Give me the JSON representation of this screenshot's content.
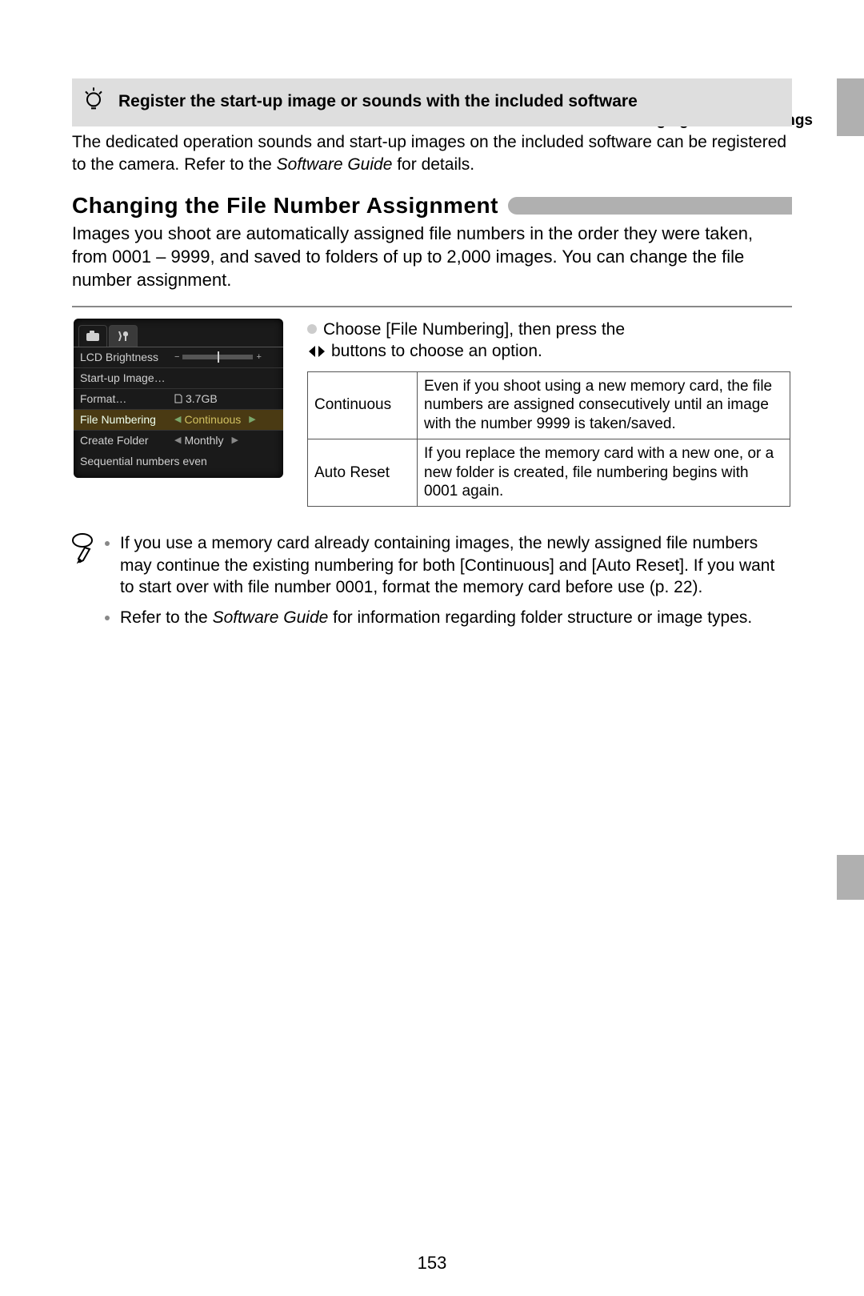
{
  "header": {
    "title": "Changing Camera Settings"
  },
  "tip": {
    "heading": "Register the start-up image or sounds with the included software",
    "body_a": "The dedicated operation sounds and start-up images on the included software can be registered to the camera. Refer to the ",
    "body_em": "Software Guide",
    "body_b": " for details."
  },
  "section": {
    "title": "Changing the File Number Assignment",
    "body": "Images you shoot are automatically assigned file numbers in the order they were taken, from 0001 – 9999, and saved to folders of up to 2,000 images. You can change the file number assignment."
  },
  "lcd": {
    "rows": {
      "brightness": "LCD Brightness",
      "startup": "Start-up Image…",
      "format": "Format…",
      "format_v": "3.7GB",
      "file_num": "File Numbering",
      "file_num_v": "Continuous",
      "folder": "Create Folder",
      "folder_v": "Monthly"
    },
    "hint": "Sequential numbers even"
  },
  "instruction": {
    "line1": "Choose [File Numbering], then press the",
    "line2": "buttons to choose an option."
  },
  "table": {
    "r1k": "Continuous",
    "r1v": "Even if you shoot using a new memory card, the file numbers are assigned consecutively until an image with the number 9999 is taken/saved.",
    "r2k": "Auto Reset",
    "r2v": "If you replace the memory card with a new one, or a new folder is created, file numbering begins with 0001 again."
  },
  "notes": {
    "n1a": "If you use a memory card already containing images, the newly assigned file numbers may continue the existing numbering for both [Continuous] and [Auto Reset]. If you want to start over with file number 0001, format the memory card before use ",
    "n1link": "(p. 22)",
    "n1b": ".",
    "n2a": "Refer to the ",
    "n2em": "Software Guide",
    "n2b": " for information regarding folder structure or image types."
  },
  "page_number": "153"
}
